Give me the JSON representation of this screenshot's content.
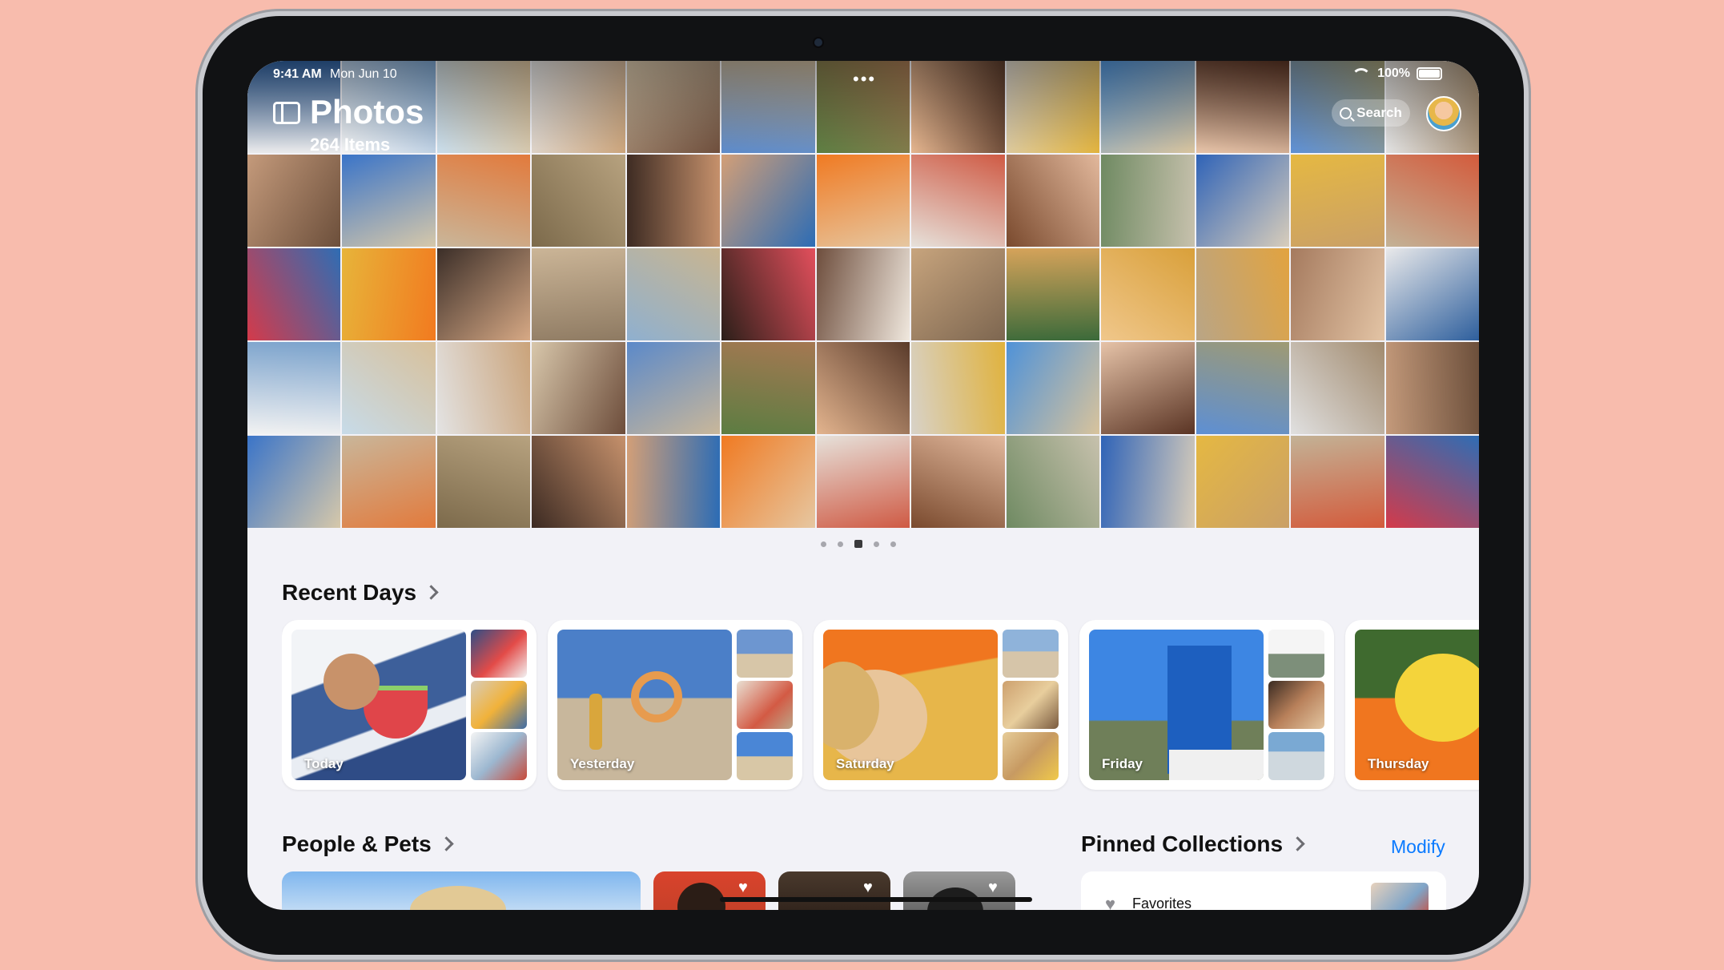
{
  "status_bar": {
    "time": "9:41 AM",
    "date": "Mon Jun 10",
    "battery": "100%"
  },
  "header": {
    "title": "Photos",
    "subtitle": "264 Items",
    "search_label": "Search"
  },
  "sections": {
    "recent_days": "Recent Days",
    "people_pets": "People & Pets",
    "pinned_collections": "Pinned Collections",
    "modify": "Modify"
  },
  "recent_days": [
    {
      "label": "Today"
    },
    {
      "label": "Yesterday"
    },
    {
      "label": "Saturday"
    },
    {
      "label": "Friday"
    },
    {
      "label": "Thursday"
    }
  ],
  "pinned": {
    "first_item": "Favorites"
  },
  "colors": {
    "background": "#F8BCAD",
    "accent": "#0A7AFF"
  }
}
